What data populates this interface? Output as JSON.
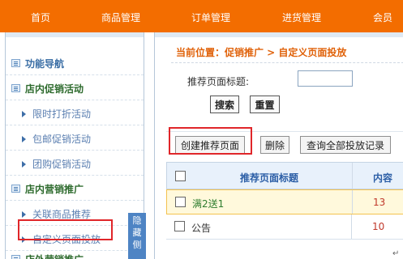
{
  "topnav": {
    "items": [
      "首页",
      "商品管理",
      "订单管理",
      "进货管理",
      "会员"
    ]
  },
  "sidebar": {
    "title": "功能导航",
    "groups": [
      {
        "label": "店内促销活动",
        "items": [
          "限时打折活动",
          "包邮促销活动",
          "团购促销活动"
        ]
      },
      {
        "label": "店内营销推广",
        "items": [
          "关联商品推荐",
          "自定义页面投放"
        ]
      },
      {
        "label": "店外营销推广",
        "items": []
      }
    ],
    "hide_tab": [
      "隐",
      "藏",
      "侧"
    ]
  },
  "main": {
    "breadcrumb": "当前位置：促销推广 > 自定义页面投放",
    "search": {
      "label": "推荐页面标题:",
      "value": "",
      "search_btn": "搜索",
      "reset_btn": "重置"
    },
    "toolbar": {
      "create_btn": "创建推荐页面",
      "delete_btn": "删除",
      "query_btn": "查询全部投放记录"
    },
    "table": {
      "headers": [
        "推荐页面标题",
        "内容"
      ],
      "rows": [
        {
          "title": "满2送1",
          "content": "13"
        },
        {
          "title": "公告",
          "content": "10"
        }
      ]
    }
  },
  "colors": {
    "brand_orange": "#f36d00",
    "highlight_red": "#e0262a",
    "link_blue": "#3a6ea5"
  }
}
